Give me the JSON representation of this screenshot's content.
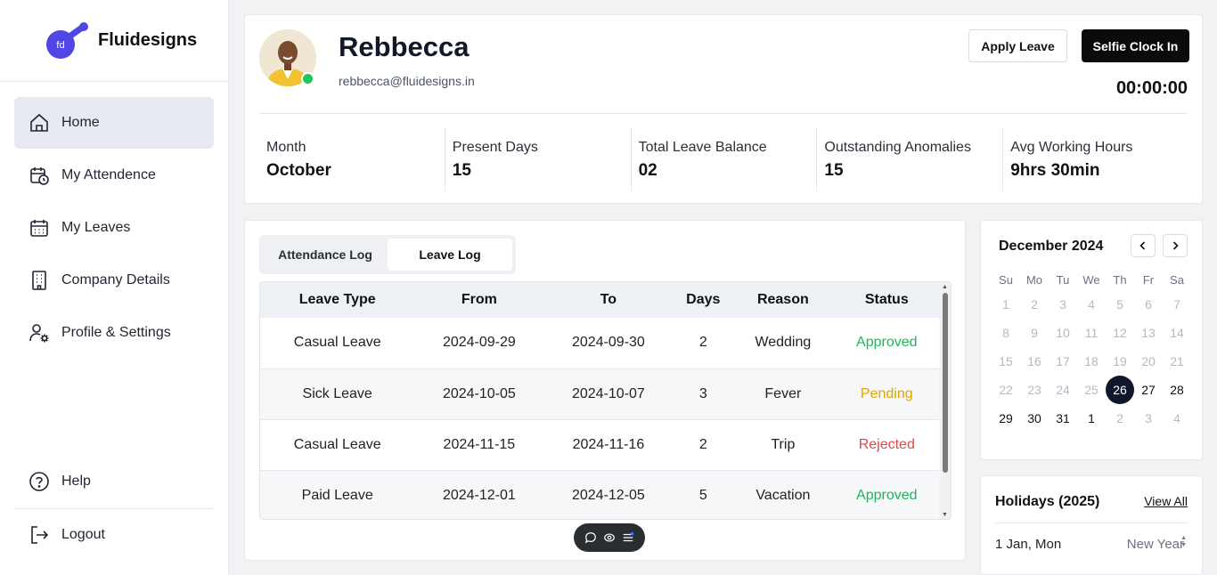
{
  "brand": {
    "logo_text": "fd",
    "name": "Fluidesigns"
  },
  "nav": {
    "items": [
      {
        "label": "Home",
        "icon": "home-icon",
        "active": true
      },
      {
        "label": "My Attendence",
        "icon": "calendar-clock-icon"
      },
      {
        "label": "My Leaves",
        "icon": "calendar-icon"
      },
      {
        "label": "Company Details",
        "icon": "building-icon"
      },
      {
        "label": "Profile & Settings",
        "icon": "user-gear-icon"
      }
    ],
    "bottom": [
      {
        "label": "Help",
        "icon": "help-icon"
      },
      {
        "label": "Logout",
        "icon": "logout-icon"
      }
    ]
  },
  "profile": {
    "name": "Rebbecca",
    "email": "rebbecca@fluidesigns.in",
    "status_color": "#22c55e",
    "apply_leave_label": "Apply Leave",
    "selfie_clock_in_label": "Selfie Clock In",
    "timer": "00:00:00"
  },
  "stats": [
    {
      "label": "Month",
      "value": "October"
    },
    {
      "label": "Present Days",
      "value": "15"
    },
    {
      "label": "Total Leave Balance",
      "value": "02"
    },
    {
      "label": "Outstanding Anomalies",
      "value": "15"
    },
    {
      "label": "Avg Working Hours",
      "value": "9hrs 30min"
    }
  ],
  "log": {
    "tabs": [
      {
        "label": "Attendance Log",
        "active": false
      },
      {
        "label": "Leave Log",
        "active": true
      }
    ],
    "columns": [
      "Leave Type",
      "From",
      "To",
      "Days",
      "Reason",
      "Status"
    ],
    "rows": [
      {
        "type": "Casual Leave",
        "from": "2024-09-29",
        "to": "2024-09-30",
        "days": "2",
        "reason": "Wedding",
        "status": "Approved"
      },
      {
        "type": "Sick Leave",
        "from": "2024-10-05",
        "to": "2024-10-07",
        "days": "3",
        "reason": "Fever",
        "status": "Pending"
      },
      {
        "type": "Casual Leave",
        "from": "2024-11-15",
        "to": "2024-11-16",
        "days": "2",
        "reason": "Trip",
        "status": "Rejected"
      },
      {
        "type": "Paid Leave",
        "from": "2024-12-01",
        "to": "2024-12-05",
        "days": "5",
        "reason": "Vacation",
        "status": "Approved"
      }
    ],
    "status_colors": {
      "Approved": "#22b45a",
      "Pending": "#e0a400",
      "Rejected": "#e24848"
    }
  },
  "calendar": {
    "title": "December 2024",
    "weekdays": [
      "Su",
      "Mo",
      "Tu",
      "We",
      "Th",
      "Fr",
      "Sa"
    ],
    "days": [
      {
        "d": "1",
        "cur": false
      },
      {
        "d": "2",
        "cur": false
      },
      {
        "d": "3",
        "cur": false
      },
      {
        "d": "4",
        "cur": false
      },
      {
        "d": "5",
        "cur": false
      },
      {
        "d": "6",
        "cur": false
      },
      {
        "d": "7",
        "cur": false
      },
      {
        "d": "8",
        "cur": false
      },
      {
        "d": "9",
        "cur": false
      },
      {
        "d": "10",
        "cur": false
      },
      {
        "d": "11",
        "cur": false
      },
      {
        "d": "12",
        "cur": false
      },
      {
        "d": "13",
        "cur": false
      },
      {
        "d": "14",
        "cur": false
      },
      {
        "d": "15",
        "cur": false
      },
      {
        "d": "16",
        "cur": false
      },
      {
        "d": "17",
        "cur": false
      },
      {
        "d": "18",
        "cur": false
      },
      {
        "d": "19",
        "cur": false
      },
      {
        "d": "20",
        "cur": false
      },
      {
        "d": "21",
        "cur": false
      },
      {
        "d": "22",
        "cur": false
      },
      {
        "d": "23",
        "cur": false
      },
      {
        "d": "24",
        "cur": false
      },
      {
        "d": "25",
        "cur": false
      },
      {
        "d": "26",
        "cur": true,
        "selected": true
      },
      {
        "d": "27",
        "cur": true
      },
      {
        "d": "28",
        "cur": true
      },
      {
        "d": "29",
        "cur": true
      },
      {
        "d": "30",
        "cur": true
      },
      {
        "d": "31",
        "cur": true
      },
      {
        "d": "1",
        "cur": true
      },
      {
        "d": "2",
        "cur": false
      },
      {
        "d": "3",
        "cur": false
      },
      {
        "d": "4",
        "cur": false
      }
    ]
  },
  "holidays": {
    "title": "Holidays (2025)",
    "view_all_label": "View All",
    "items": [
      {
        "date": "1 Jan, Mon",
        "name": "New Year"
      }
    ]
  }
}
